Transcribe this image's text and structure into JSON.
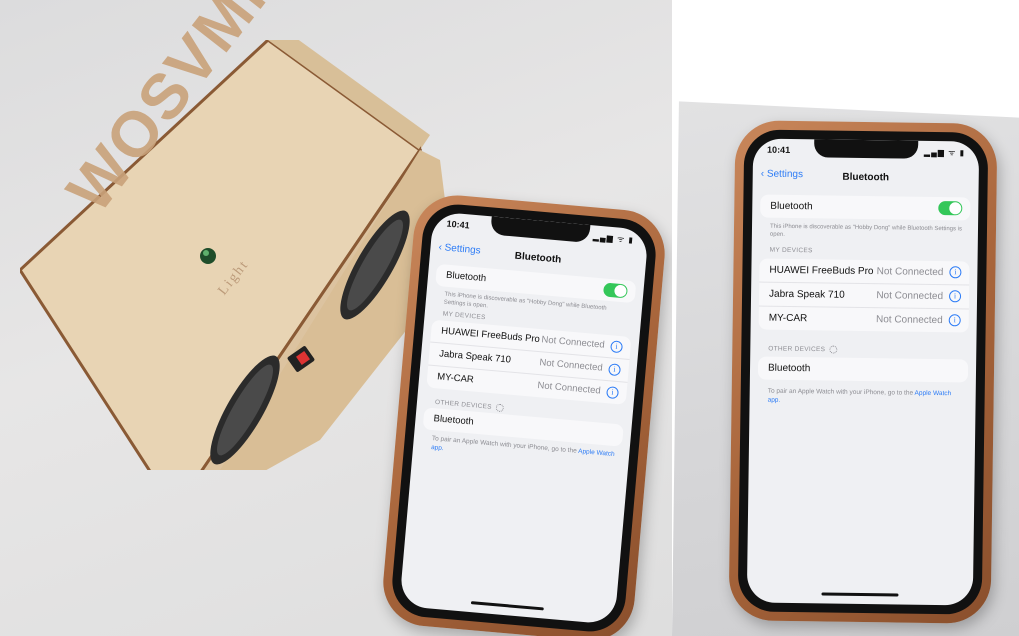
{
  "scene": {
    "brand_logo": "WOSVMN",
    "brand_subtitle": "Light"
  },
  "phone": {
    "status_time": "10:41",
    "status_icons": "▂▄▆ ᯤ ▮",
    "back_label": "Settings",
    "nav_title": "Bluetooth",
    "bluetooth_label": "Bluetooth",
    "bluetooth_on": true,
    "discoverable_note": "This iPhone is discoverable as \"Hobby Dong\" while Bluetooth Settings is open.",
    "my_devices_header": "MY DEVICES",
    "devices": [
      {
        "name": "HUAWEI FreeBuds Pro",
        "status": "Not Connected"
      },
      {
        "name": "Jabra Speak 710",
        "status": "Not Connected"
      },
      {
        "name": "MY-CAR",
        "status": "Not Connected"
      }
    ],
    "other_devices_header": "OTHER DEVICES",
    "other_devices": [
      {
        "name": "Bluetooth"
      }
    ],
    "pair_note": "To pair an Apple Watch with your iPhone, go to the",
    "pair_link": "Apple Watch app."
  }
}
